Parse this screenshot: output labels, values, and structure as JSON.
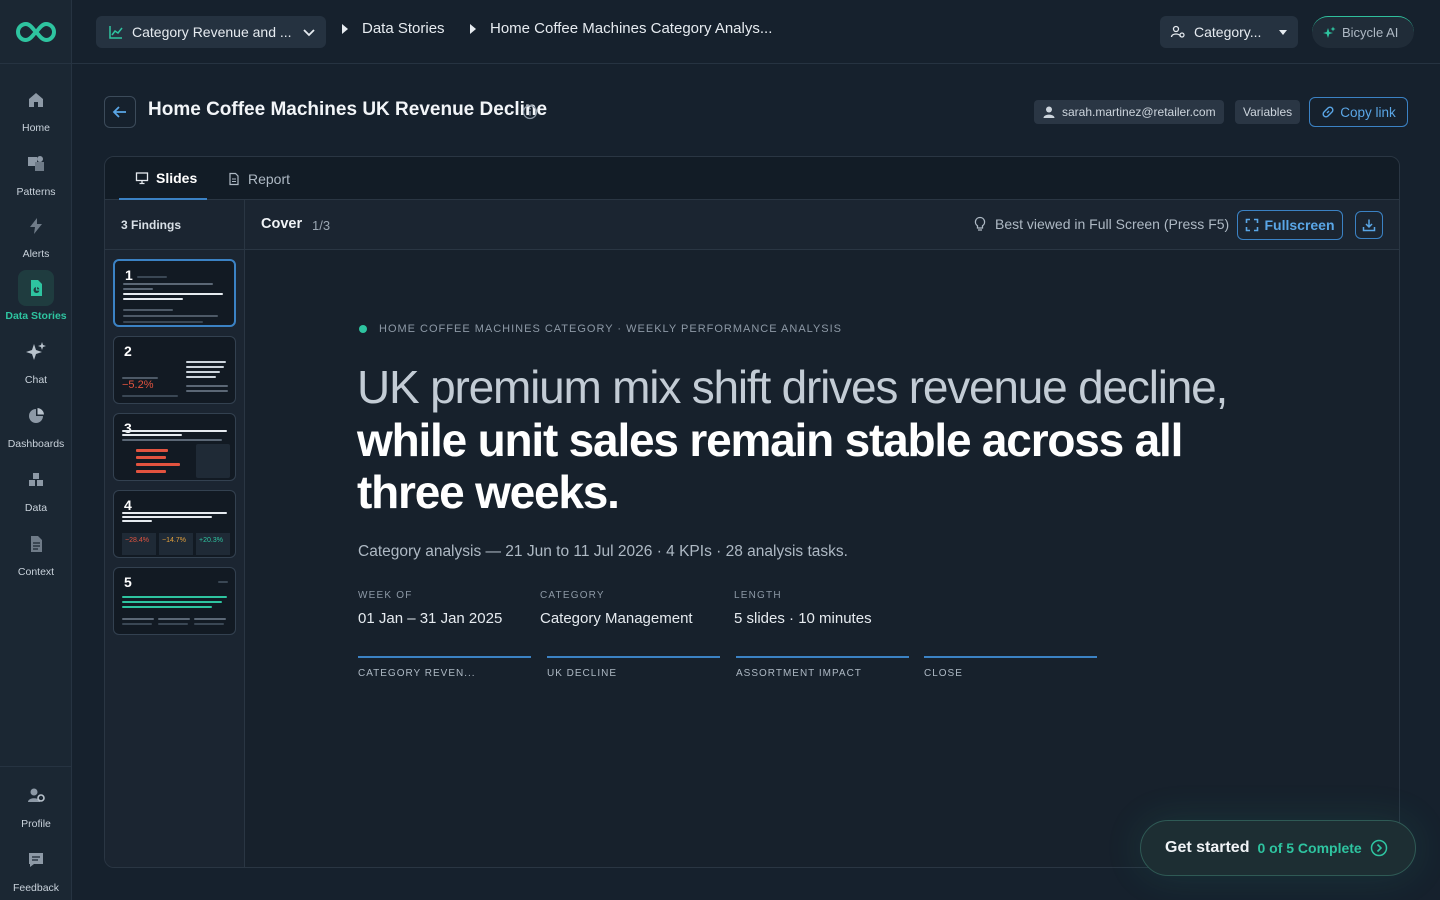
{
  "nav": {
    "items": [
      {
        "label": "Home",
        "icon": "home-icon"
      },
      {
        "label": "Patterns",
        "icon": "patterns-icon"
      },
      {
        "label": "Alerts",
        "icon": "bolt-icon"
      },
      {
        "label": "Data Stories",
        "icon": "story-icon"
      },
      {
        "label": "Chat",
        "icon": "sparkle-icon"
      },
      {
        "label": "Dashboards",
        "icon": "pie-icon"
      },
      {
        "label": "Data",
        "icon": "cubes-icon"
      },
      {
        "label": "Context",
        "icon": "document-icon"
      }
    ],
    "bottom": [
      {
        "label": "Profile",
        "icon": "profile-gear-icon"
      },
      {
        "label": "Feedback",
        "icon": "feedback-icon"
      }
    ]
  },
  "topbar": {
    "workspace": "Category Revenue and ...",
    "breadcrumbs": [
      "Data Stories",
      "Home Coffee Machines Category Analys..."
    ],
    "category": "Category...",
    "ai_label": "Bicycle AI"
  },
  "header": {
    "title": "Home Coffee Machines UK Revenue Decline",
    "user": "sarah.martinez@retailer.com",
    "variables": "Variables",
    "copy_link": "Copy link"
  },
  "tabs": [
    "Slides",
    "Report"
  ],
  "findings": {
    "label": "3 Findings",
    "thumbs": [
      {
        "num": "1"
      },
      {
        "num": "2"
      },
      {
        "num": "3"
      },
      {
        "num": "4"
      },
      {
        "num": "5"
      }
    ]
  },
  "slide_bar": {
    "name": "Cover",
    "count": "1/3",
    "hint": "Best viewed in Full Screen (Press F5)",
    "fullscreen": "Fullscreen"
  },
  "slide": {
    "kicker": "HOME COFFEE MACHINES CATEGORY · WEEKLY PERFORMANCE ANALYSIS",
    "headline_light": "UK premium mix shift drives revenue decline,",
    "headline_bold": "while unit sales remain stable across all three weeks.",
    "subline": "Category analysis — 21 Jun to 11 Jul 2026 · 4 KPIs · 28 analysis tasks.",
    "meta": [
      {
        "label": "WEEK OF",
        "value": "01 Jan – 31 Jan 2025"
      },
      {
        "label": "CATEGORY",
        "value": "Category Management"
      },
      {
        "label": "LENGTH",
        "value": "5 slides · 10 minutes"
      }
    ],
    "progress": [
      "CATEGORY REVEN...",
      "UK DECLINE",
      "ASSORTMENT IMPACT",
      "CLOSE"
    ]
  },
  "get_started": {
    "title": "Get started",
    "progress": "0 of 5 Complete"
  },
  "colors": {
    "accent_teal": "#2ec4a0",
    "accent_blue": "#3b82c4",
    "background": "#16212d",
    "negative_red": "#e2533f"
  }
}
